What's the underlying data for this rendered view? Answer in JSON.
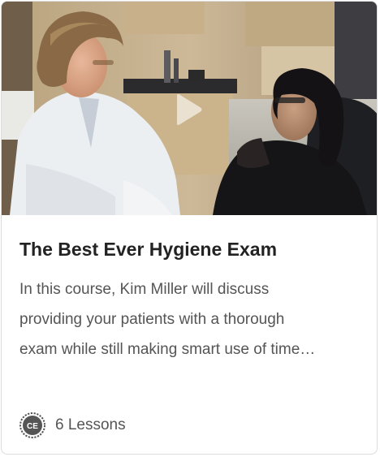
{
  "course": {
    "title": "The Best Ever Hygiene Exam",
    "description_lines": [
      "In this course, Kim Miller will discuss",
      "providing your patients with a thorough",
      "exam while still making smart use of time…"
    ],
    "lessons_label": "6 Lessons",
    "badge_text": "CE"
  },
  "thumbnail": {
    "alt": "Course video thumbnail",
    "overlay_icon": "play-icon"
  },
  "colors": {
    "title": "#222222",
    "body_text": "#555555",
    "badge": "#555555",
    "border": "#dcdcdc"
  }
}
